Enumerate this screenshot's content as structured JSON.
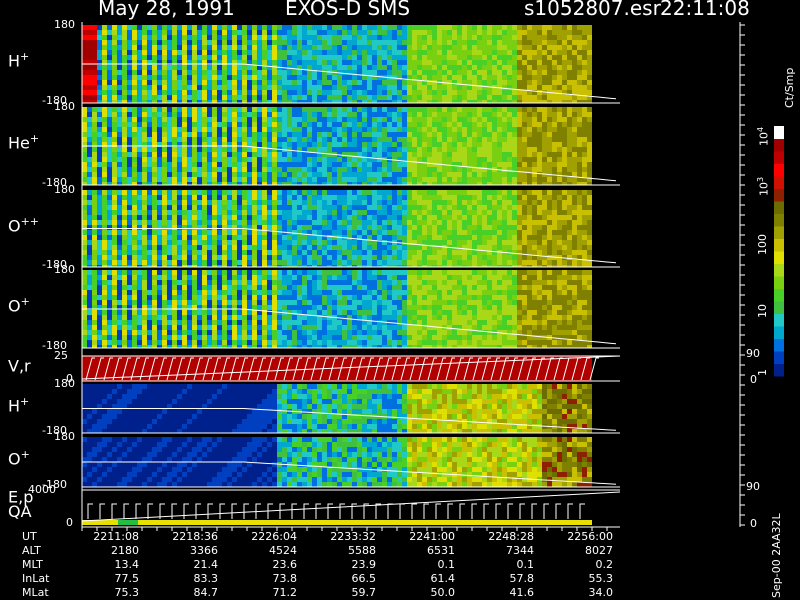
{
  "header": {
    "date": "May 28, 1991",
    "mission": "EXOS-D SMS",
    "file": "s1052807.esr",
    "time": "22:11:08"
  },
  "colorbar": {
    "unit": "Ct/Smp",
    "ticks": [
      "1",
      "10",
      "100",
      "10",
      "10"
    ],
    "tick_superscripts": [
      "",
      "",
      "",
      "3",
      "4"
    ],
    "colors": [
      "#00208c",
      "#0040c0",
      "#0070e0",
      "#00a8d0",
      "#20c8c8",
      "#40c040",
      "#48d028",
      "#78d010",
      "#a8d818",
      "#e0e000",
      "#c8c000",
      "#a0a000",
      "#808000",
      "#6c6c00",
      "#8c2000",
      "#d01000",
      "#ff0000",
      "#c00000",
      "#a00000",
      "#ffffff"
    ]
  },
  "panels": [
    {
      "label": "H",
      "sup": "+",
      "ymax": "180",
      "ymin": "-180"
    },
    {
      "label": "He",
      "sup": "+",
      "ymax": "180",
      "ymin": "-180"
    },
    {
      "label": "O",
      "sup": "++",
      "ymax": "180",
      "ymin": "-180"
    },
    {
      "label": "O",
      "sup": "+",
      "ymax": "180",
      "ymin": "-180"
    },
    {
      "label": "V,r",
      "sup": "",
      "ymax": "25",
      "ymin": "0",
      "rmax": "90",
      "rmin": "0"
    },
    {
      "label": "H",
      "sup": "+",
      "ymax": "180",
      "ymin": "-180"
    },
    {
      "label": "O",
      "sup": "+",
      "ymax": "180",
      "ymin": "-180"
    },
    {
      "label": "E,p",
      "label2": "QA",
      "sup": "",
      "ymax": "4000",
      "ymin": "0",
      "rmax": "90",
      "rmin": "0"
    }
  ],
  "side_id": "Sep-00 2AA32L",
  "chart_data": {
    "type": "heatmap",
    "title": "May 28, 1991 EXOS-D SMS s1052807.esr 22:11:08",
    "time_ticks": [
      "2211:08",
      "2218:36",
      "2226:04",
      "2233:32",
      "2241:00",
      "2248:28",
      "2256:00"
    ],
    "ephemeris": [
      {
        "name": "UT",
        "values": [
          "2211:08",
          "2218:36",
          "2226:04",
          "2233:32",
          "2241:00",
          "2248:28",
          "2256:00"
        ]
      },
      {
        "name": "ALT",
        "values": [
          "2180",
          "3366",
          "4524",
          "5588",
          "6531",
          "7344",
          "8027"
        ]
      },
      {
        "name": "MLT",
        "values": [
          "13.4",
          "21.4",
          "23.6",
          "23.9",
          "0.1",
          "0.1",
          "0.2"
        ]
      },
      {
        "name": "InLat",
        "values": [
          "77.5",
          "83.3",
          "73.8",
          "66.5",
          "61.4",
          "57.8",
          "55.3"
        ]
      },
      {
        "name": "MLat",
        "values": [
          "75.3",
          "84.7",
          "71.2",
          "59.7",
          "50.0",
          "41.6",
          "34.0"
        ]
      }
    ],
    "colorbar_unit": "Ct/Smp",
    "colorbar_range": [
      1,
      10000
    ],
    "colorbar_scale": "log"
  }
}
